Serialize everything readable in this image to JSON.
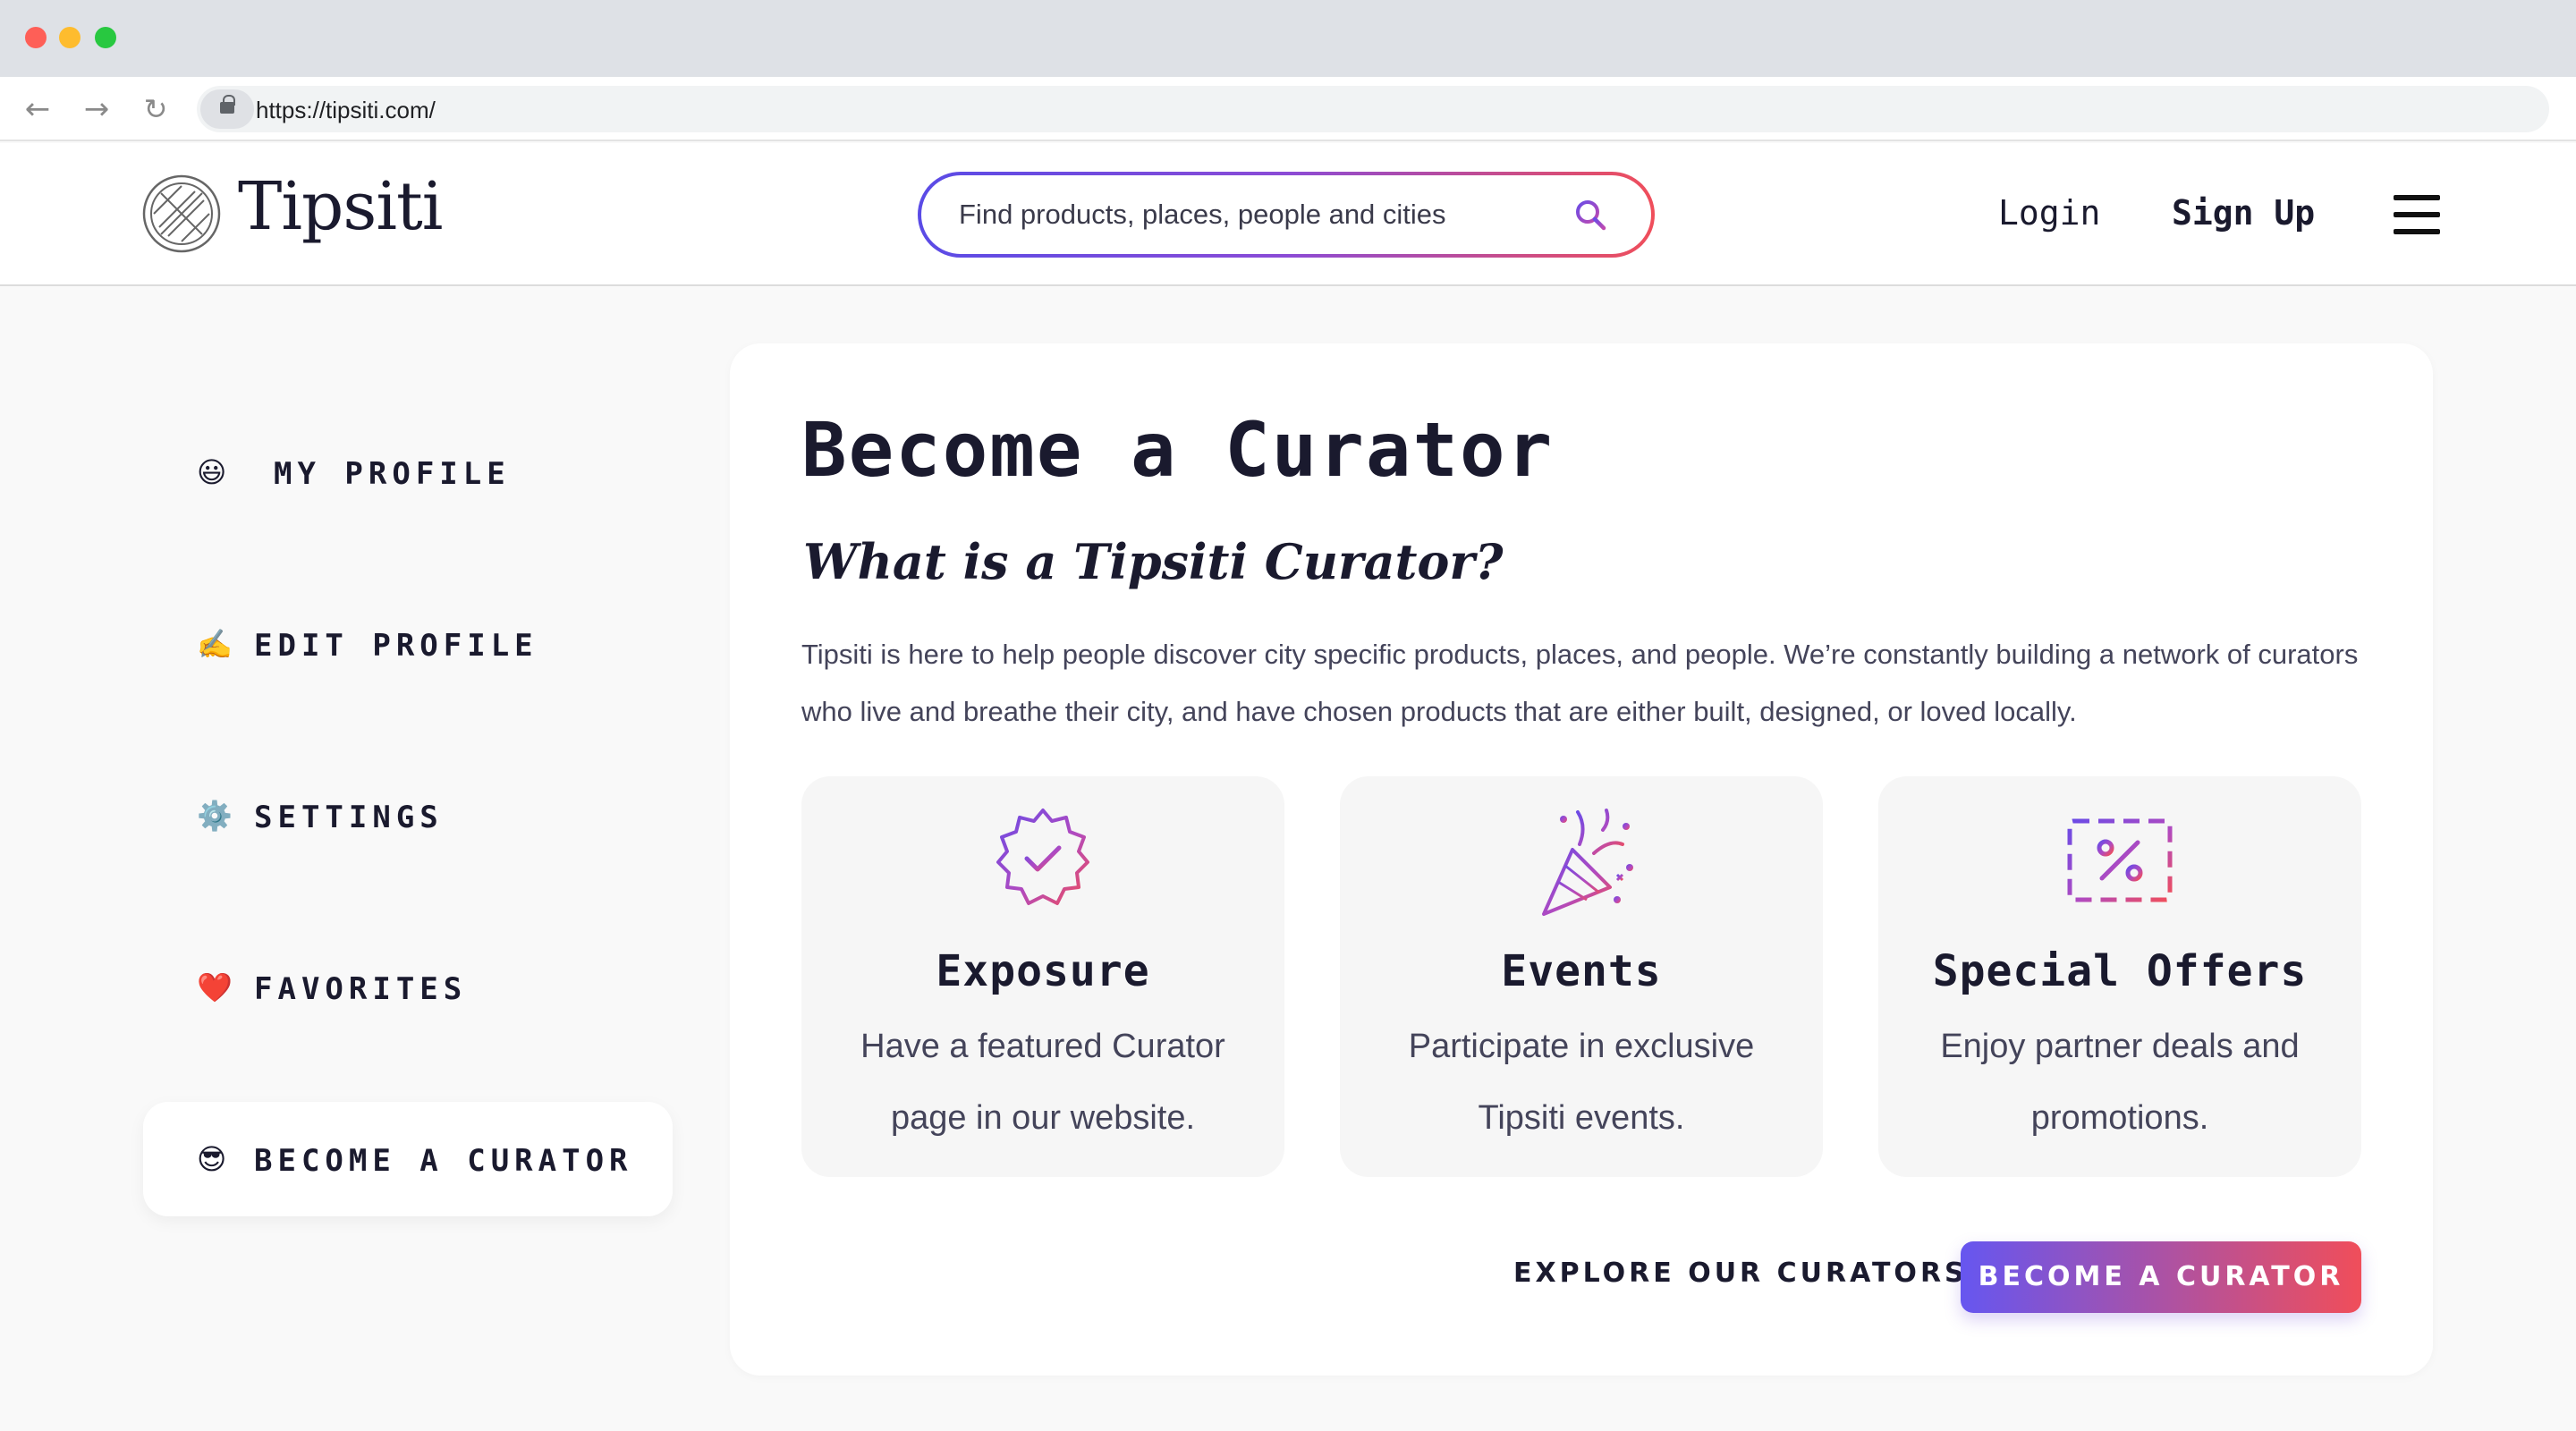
{
  "browser": {
    "url": "https://tipsiti.com/",
    "nav": {
      "back": "←",
      "forward": "→",
      "reload": "↻"
    }
  },
  "header": {
    "brand": "Tipsiti",
    "search_placeholder": "Find products, places, people and cities",
    "login": "Login",
    "signup": "Sign Up"
  },
  "sidebar": {
    "items": [
      {
        "emoji": "😃",
        "label": "MY PROFILE",
        "active": false
      },
      {
        "emoji": "✍️",
        "label": "EDIT PROFILE",
        "active": false
      },
      {
        "emoji": "⚙️",
        "label": "SETTINGS",
        "active": false
      },
      {
        "emoji": "❤️",
        "label": "FAVORITES",
        "active": false
      },
      {
        "emoji": "😎",
        "label": "BECOME A CURATOR",
        "active": true
      }
    ]
  },
  "main": {
    "title": "Become a Curator",
    "subtitle": "What is a Tipsiti Curator?",
    "intro": "Tipsiti is here to help people discover city specific products, places, and people. We’re constantly building a network of curators who live and breathe their city, and have chosen products that are either built, designed, or loved locally.",
    "features": [
      {
        "icon": "badge-check-icon",
        "title": "Exposure",
        "desc": "Have a featured Curator page in our website."
      },
      {
        "icon": "party-popper-icon",
        "title": "Events",
        "desc": "Participate in exclusive Tipsiti events."
      },
      {
        "icon": "discount-ticket-icon",
        "title": "Special Offers",
        "desc": "Enjoy partner deals and promotions."
      }
    ],
    "explore_label": "EXPLORE OUR CURATORS",
    "cta_label": "BECOME A CURATOR"
  },
  "colors": {
    "gradient_start": "#5a4be6",
    "gradient_end": "#f04e5a",
    "text_dark": "#1a1a2e"
  }
}
